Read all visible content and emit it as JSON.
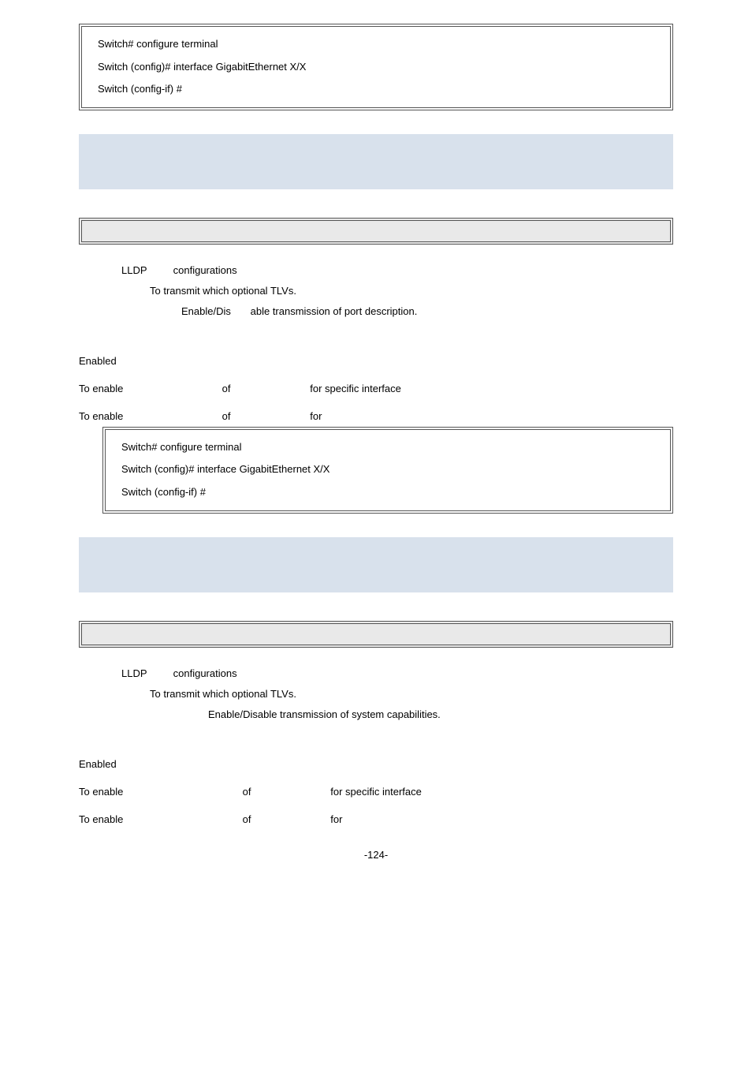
{
  "box1": {
    "l1": "Switch# configure terminal",
    "l2": "Switch (config)# interface GigabitEthernet X/X",
    "l3": "Switch (config-if) #"
  },
  "s1": {
    "line1_a": "LLDP",
    "line1_b": "configurations",
    "line2": "To transmit which optional TLVs.",
    "line3_a": "Enable/Dis",
    "line3_b": "able transmission of port description.",
    "enabled": "Enabled",
    "enable_line1_a": "To enable",
    "enable_line1_b": "of",
    "enable_line1_c": "for specific interface",
    "enable_line2_a": "To enable",
    "enable_line2_b": "of",
    "enable_line2_c": "for"
  },
  "box2": {
    "l1": "Switch# configure terminal",
    "l2": "Switch (config)# interface GigabitEthernet X/X",
    "l3": "Switch (config-if) #"
  },
  "s2": {
    "line1_a": "LLDP",
    "line1_b": "configurations",
    "line2": "To transmit which optional TLVs.",
    "line3": "Enable/Disable transmission of system capabilities.",
    "enabled": "Enabled",
    "enable_line1_a": "To enable",
    "enable_line1_b": "of",
    "enable_line1_c": "for specific interface",
    "enable_line2_a": "To enable",
    "enable_line2_b": "of",
    "enable_line2_c": "for"
  },
  "page_num": "-124-"
}
